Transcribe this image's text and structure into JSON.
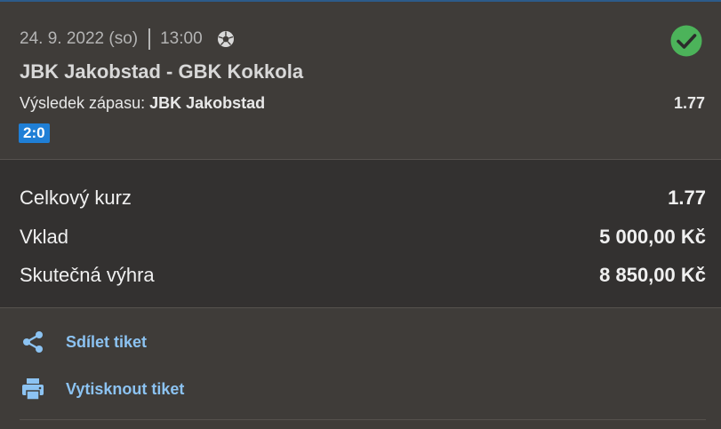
{
  "ticket": {
    "date": "24. 9. 2022 (so)",
    "time": "13:00",
    "sport_icon": "soccer-ball-icon",
    "status_icon": "check-circle-icon",
    "status_color": "#4cb35a",
    "match": "JBK Jakobstad - GBK Kokkola",
    "market_label": "Výsledek zápasu:",
    "selection": "JBK Jakobstad",
    "odds": "1.77",
    "score": "2:0",
    "score_color": "#1f7fd6"
  },
  "summary": {
    "rows": [
      {
        "label": "Celkový kurz",
        "value": "1.77"
      },
      {
        "label": "Vklad",
        "value": "5 000,00 Kč"
      },
      {
        "label": "Skutečná výhra",
        "value": "8 850,00 Kč"
      }
    ]
  },
  "actions": {
    "share_label": "Sdílet tiket",
    "share_icon": "share-icon",
    "print_label": "Vytisknout tiket",
    "print_icon": "printer-icon",
    "accent": "#8cc3f2"
  }
}
